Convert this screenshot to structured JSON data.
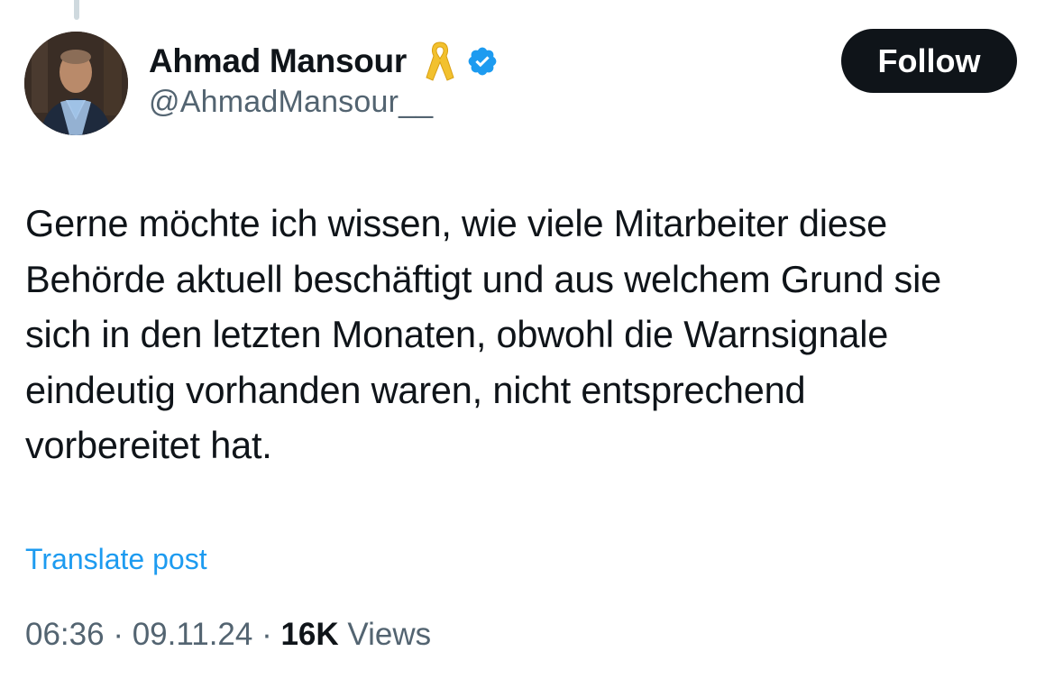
{
  "author": {
    "display_name": "Ahmad Mansour",
    "handle": "@AhmadMansour__",
    "avatar_icon": "profile-photo",
    "badge_icons": [
      "yellow-ribbon-icon",
      "verified-badge-icon"
    ],
    "verified_color": "#1d9bf0",
    "ribbon_color": "#f2c12e"
  },
  "follow_button": {
    "label": "Follow"
  },
  "post": {
    "lines": [
      "Gerne möchte ich wissen, wie viele Mitarbeiter diese",
      "Behörde aktuell beschäftigt und aus welchem Grund sie",
      "sich in den letzten Monaten, obwohl die Warnsignale",
      "eindeutig vorhanden waren, nicht entsprechend",
      "vorbereitet hat."
    ]
  },
  "translate": {
    "label": "Translate post"
  },
  "meta": {
    "time": "06:36",
    "separator": " · ",
    "date": "09.11.24",
    "views_count": "16K",
    "views_label": "Views"
  },
  "colors": {
    "text_primary": "#0f1419",
    "text_secondary": "#536471",
    "link": "#1d9bf0",
    "button_bg": "#0f1419"
  }
}
